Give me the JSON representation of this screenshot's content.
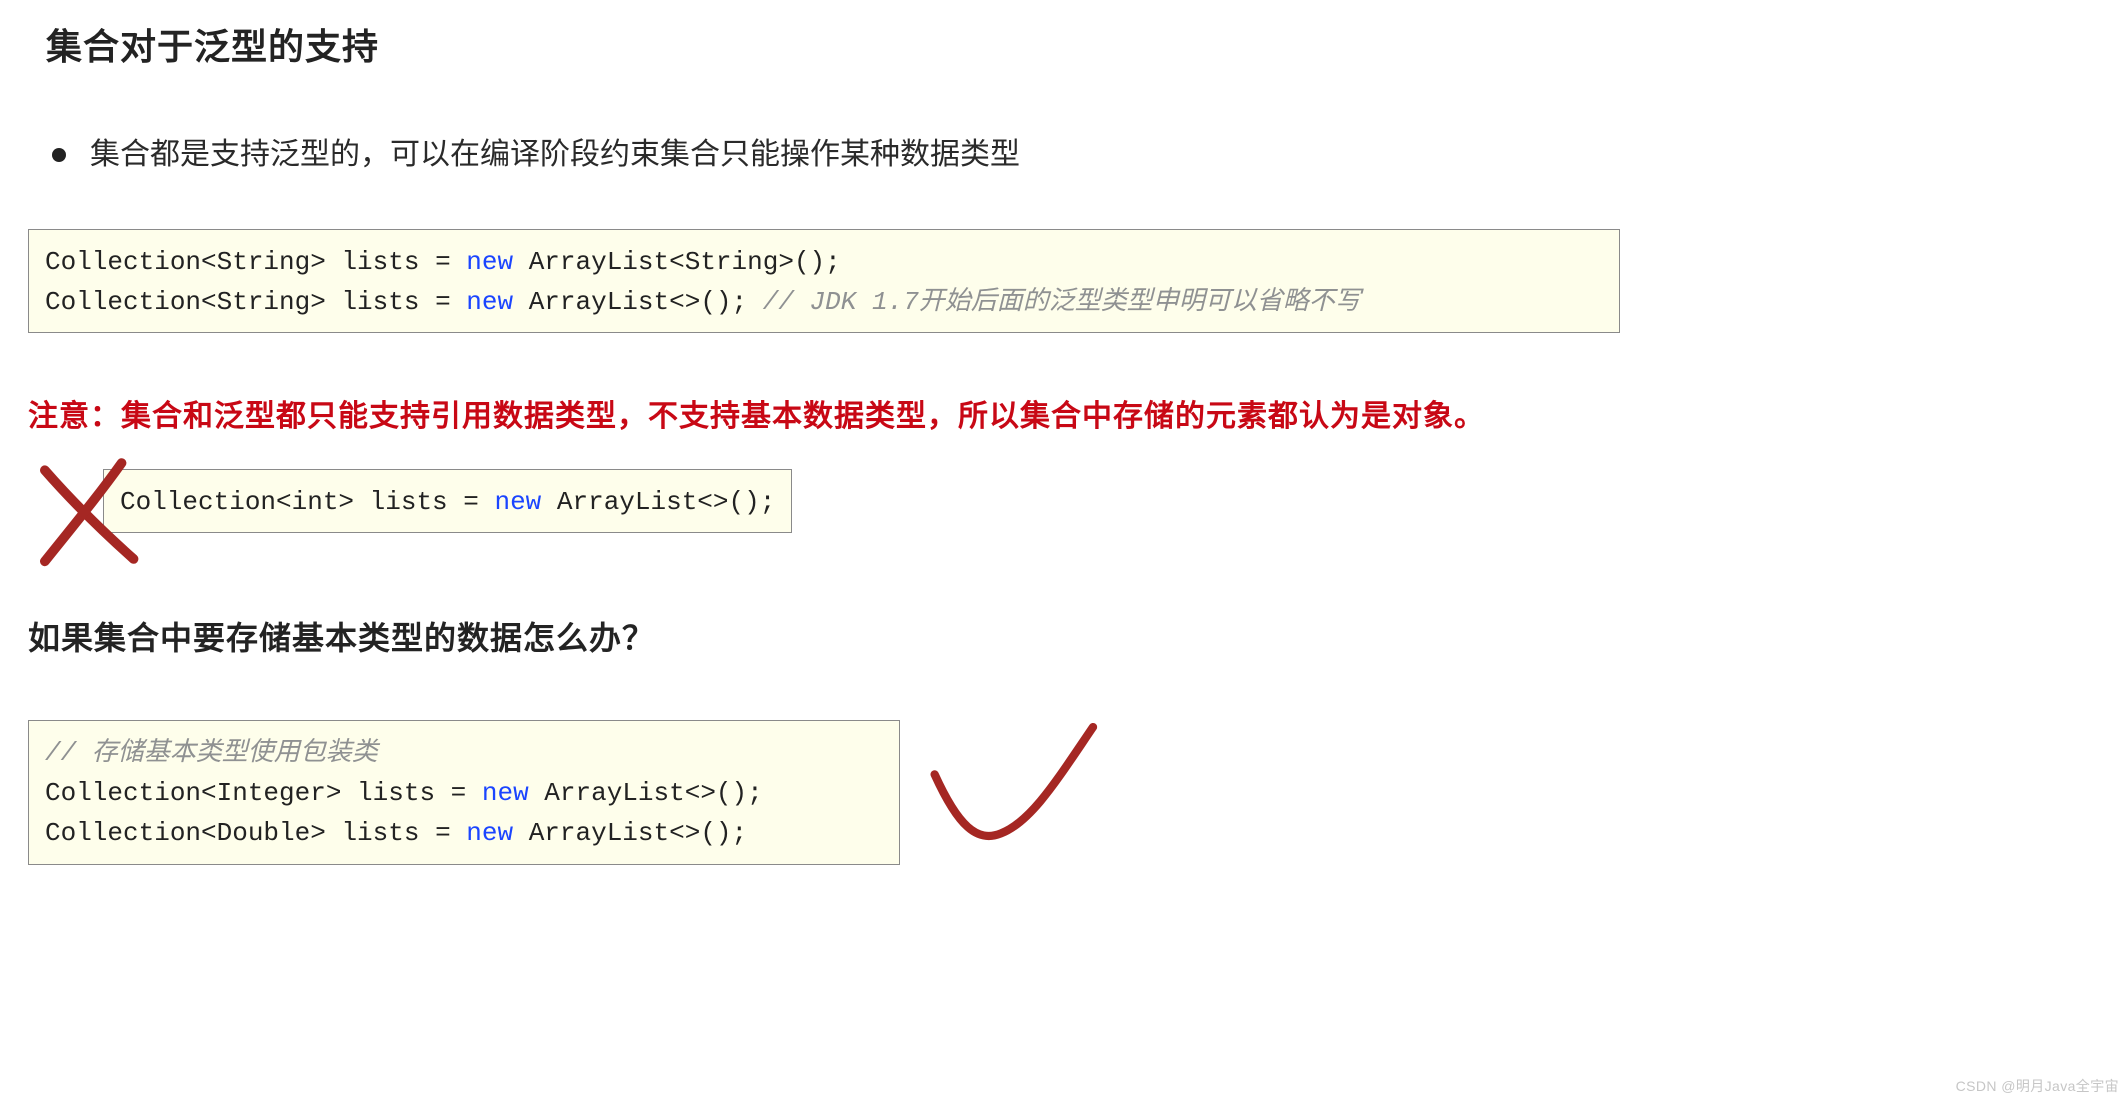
{
  "heading": "集合对于泛型的支持",
  "bullet": "集合都是支持泛型的，可以在编译阶段约束集合只能操作某种数据类型",
  "code1": {
    "t1": "Collection<String> lists = ",
    "kw1": "new",
    "t2": " ArrayList<String>();",
    "t3": "Collection<String> lists = ",
    "kw2": "new",
    "t4": " ArrayList<>(); ",
    "cmt": "// JDK 1.7开始后面的泛型类型申明可以省略不写"
  },
  "red_note": "注意：集合和泛型都只能支持引用数据类型，不支持基本数据类型，所以集合中存储的元素都认为是对象。",
  "code2": {
    "t1": "Collection<int> lists = ",
    "kw1": "new",
    "t2": " ArrayList<>();"
  },
  "subheading": "如果集合中要存储基本类型的数据怎么办？",
  "code3": {
    "cmt": "// 存储基本类型使用包装类",
    "t1": "Collection<Integer> lists = ",
    "kw1": "new",
    "t2": " ArrayList<>();",
    "t3": "Collection<Double> lists = ",
    "kw2": "new",
    "t4": " ArrayList<>();"
  },
  "watermark": "CSDN @明月Java全宇宙"
}
